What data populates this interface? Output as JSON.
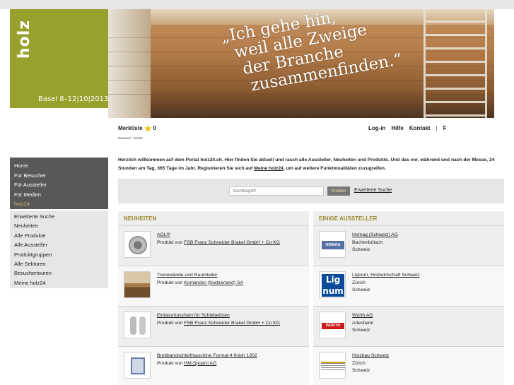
{
  "header": {
    "logo": "holz",
    "logo_date": "Basel 8–12|10|2013",
    "banner_quote": "„Ich gehe hin,\n  weil alle Zweige\n   der Branche\n    zusammenfinden.“"
  },
  "toolbar": {
    "merkliste_label": "Merkliste",
    "merkliste_count": "0",
    "powered": "Powered : holz24",
    "nav": [
      "Log-in",
      "Hilfe",
      "Kontakt",
      "|",
      "F"
    ]
  },
  "sidebar": {
    "primary": [
      "Home",
      "Für Besucher",
      "Für Aussteller",
      "Für Medien",
      "holz24"
    ],
    "secondary": [
      "Erweiterte Suche",
      "Neuheiten",
      "Alle Produkte",
      "Alle Aussteller",
      "Produktgruppen",
      "Alle Sektoren",
      "Besuchertouren",
      "Meine holz24"
    ]
  },
  "intro": {
    "text": "Herzlich willkommen auf dem Portal holz24.ch. Hier finden Sie aktuell und rasch alle Aussteller, Neuheiten und Produkte. Und das vor, während und nach der Messe, 24 Stunden am Tag, 365 Tage im Jahr. Registrieren Sie sich auf ",
    "link": "Meine holz24",
    "text_end": ", um auf weitere Funktionalitäten zuzugreifen."
  },
  "search": {
    "placeholder": "Suchbegriff",
    "button": "Finden",
    "advanced": "Erweiterte Suche"
  },
  "neuheiten": {
    "title": "NEUHEITEN",
    "items": [
      {
        "name": "AGL®",
        "prefix": "Produkt von",
        "vendor": "FSB Franz Schneider Brakel GmbH + Co KG"
      },
      {
        "name": "Trennwände und Raumteiler",
        "prefix": "Produkt von",
        "vendor": "Komandor (Switzerland) SA"
      },
      {
        "name": "Einlassmuscheln für Schiebetüren",
        "prefix": "Produkt von",
        "vendor": "FSB Franz Schneider Brakel GmbH + Co KG"
      },
      {
        "name": "Breitbandschleifmaschine Format-4 finish 1302",
        "prefix": "Produkt von",
        "vendor": "HM-Spoerri AG"
      }
    ]
  },
  "aussteller": {
    "title": "EINIGE AUSSTELLER",
    "items": [
      {
        "name": "Homag (Schweiz) AG",
        "city": "Bachenbülach",
        "country": "Schweiz",
        "logo": "HOMAG"
      },
      {
        "name": "Lignum, Holzwirtschaft Schweiz",
        "city": "Zürich",
        "country": "Schweiz",
        "logo": "Lig num"
      },
      {
        "name": "Würth AG",
        "city": "Arlesheim",
        "country": "Schweiz",
        "logo": "WÜRTH"
      },
      {
        "name": "Holzbau Schweiz",
        "city": "Zürich",
        "country": "Schweiz",
        "logo": ""
      }
    ]
  },
  "colors": {
    "logo_green": "#98a12b",
    "nav_dark": "#585858",
    "panel_head": "#9b8a2e"
  }
}
